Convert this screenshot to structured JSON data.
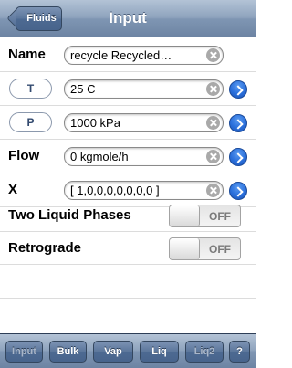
{
  "navbar": {
    "back_label": "Fluids",
    "title": "Input"
  },
  "rows": {
    "name": {
      "label": "Name",
      "value": "recycle Recycled…"
    },
    "T": {
      "button": "T",
      "value": "25 C"
    },
    "P": {
      "button": "P",
      "value": "1000 kPa"
    },
    "flow": {
      "label": "Flow",
      "value": "0 kgmole/h"
    },
    "X": {
      "label": "X",
      "value": "[ 1,0,0,0,0,0,0,0 ]"
    },
    "two_liquid": {
      "label": "Two Liquid Phases",
      "toggle": "OFF"
    },
    "retrograde": {
      "label": "Retrograde",
      "toggle": "OFF"
    }
  },
  "toolbar": {
    "input": "Input",
    "bulk": "Bulk",
    "vap": "Vap",
    "liq": "Liq",
    "liq2": "Liq2",
    "help": "?"
  },
  "colors": {
    "accent_blue": "#2a6fdb",
    "bar": "#8ea3bd"
  }
}
